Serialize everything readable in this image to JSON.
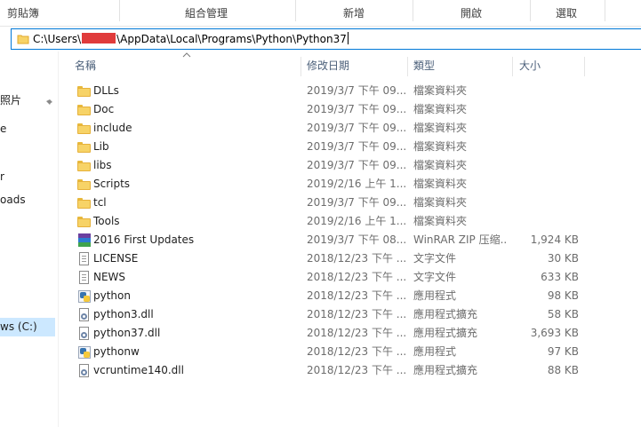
{
  "ribbon": {
    "groups": [
      "剪貼簿",
      "組合管理",
      "新增",
      "開啟",
      "選取"
    ]
  },
  "address": {
    "path_prefix": "C:\\Users\\",
    "path_suffix": "\\AppData\\Local\\Programs\\Python\\Python37"
  },
  "nav": {
    "items": [
      {
        "label": "照片",
        "selected": false,
        "pinned": true
      },
      {
        "label": "e",
        "selected": false,
        "pinned": false
      },
      {
        "label": "r",
        "selected": false,
        "pinned": false
      },
      {
        "label": "oads",
        "selected": false,
        "pinned": false
      },
      {
        "label": "ws (C:)",
        "selected": true,
        "pinned": false
      }
    ]
  },
  "columns": {
    "name": "名稱",
    "date": "修改日期",
    "type": "類型",
    "size": "大小"
  },
  "files": [
    {
      "name": "DLLs",
      "date": "2019/3/7 下午 09...",
      "type": "檔案資料夾",
      "size": "",
      "icon": "folder-icon"
    },
    {
      "name": "Doc",
      "date": "2019/3/7 下午 09...",
      "type": "檔案資料夾",
      "size": "",
      "icon": "folder-icon"
    },
    {
      "name": "include",
      "date": "2019/3/7 下午 09...",
      "type": "檔案資料夾",
      "size": "",
      "icon": "folder-icon"
    },
    {
      "name": "Lib",
      "date": "2019/3/7 下午 09...",
      "type": "檔案資料夾",
      "size": "",
      "icon": "folder-icon"
    },
    {
      "name": "libs",
      "date": "2019/3/7 下午 09...",
      "type": "檔案資料夾",
      "size": "",
      "icon": "folder-icon"
    },
    {
      "name": "Scripts",
      "date": "2019/2/16 上午 1...",
      "type": "檔案資料夾",
      "size": "",
      "icon": "folder-icon"
    },
    {
      "name": "tcl",
      "date": "2019/3/7 下午 09...",
      "type": "檔案資料夾",
      "size": "",
      "icon": "folder-icon"
    },
    {
      "name": "Tools",
      "date": "2019/2/16 上午 1...",
      "type": "檔案資料夾",
      "size": "",
      "icon": "folder-icon"
    },
    {
      "name": "2016 First Updates",
      "date": "2019/3/7 下午 08...",
      "type": "WinRAR ZIP 压缩...",
      "size": "1,924 KB",
      "icon": "winrar-archive-icon"
    },
    {
      "name": "LICENSE",
      "date": "2018/12/23 下午 ...",
      "type": "文字文件",
      "size": "30 KB",
      "icon": "text-document-icon"
    },
    {
      "name": "NEWS",
      "date": "2018/12/23 下午 ...",
      "type": "文字文件",
      "size": "633 KB",
      "icon": "text-document-icon"
    },
    {
      "name": "python",
      "date": "2018/12/23 下午 ...",
      "type": "應用程式",
      "size": "98 KB",
      "icon": "python-app-icon"
    },
    {
      "name": "python3.dll",
      "date": "2018/12/23 下午 ...",
      "type": "應用程式擴充",
      "size": "58 KB",
      "icon": "dll-file-icon"
    },
    {
      "name": "python37.dll",
      "date": "2018/12/23 下午 ...",
      "type": "應用程式擴充",
      "size": "3,693 KB",
      "icon": "dll-file-icon"
    },
    {
      "name": "pythonw",
      "date": "2018/12/23 下午 ...",
      "type": "應用程式",
      "size": "97 KB",
      "icon": "python-app-icon"
    },
    {
      "name": "vcruntime140.dll",
      "date": "2018/12/23 下午 ...",
      "type": "應用程式擴充",
      "size": "88 KB",
      "icon": "dll-file-icon"
    }
  ]
}
